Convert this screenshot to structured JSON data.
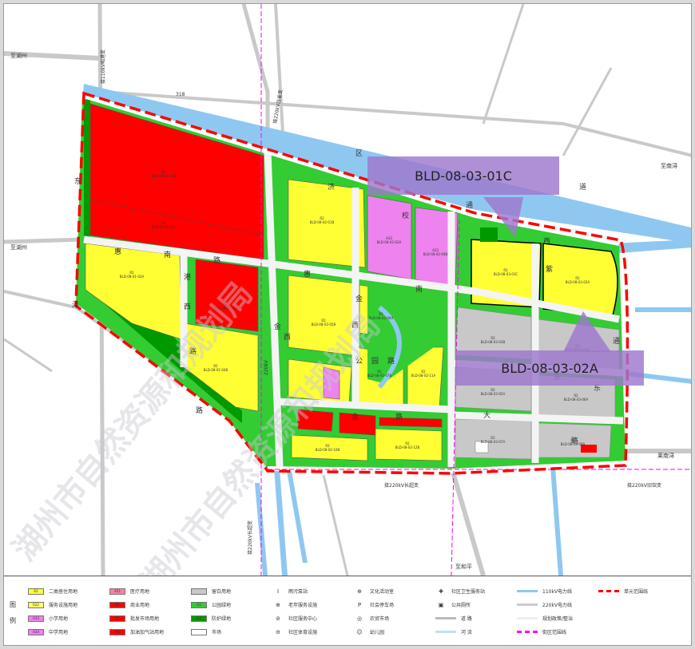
{
  "map": {
    "place_labels": {
      "to_huzhou_top": "至湖州",
      "to_huzhou_left": "至湖州",
      "to_nanxun": "至南浔",
      "to_lainan": "莱南浔",
      "to_heping": "至和平",
      "line_110kv": "接110kV昭港变",
      "line_220kv_left": "接220kV白雀变",
      "line_220kv_bottom": "接220kV长超变",
      "line_220kv_right": "接220kV旧馆变",
      "line_220kv_south": "接220kV长超变",
      "road_318": "318",
      "road_220kv_mid": "220kV"
    },
    "road_chars": {
      "hui": "惠",
      "nan": "南",
      "lu": "路",
      "jin": "金",
      "xi": "西",
      "dong": "东",
      "qu": "区",
      "tong": "通",
      "dao": "道",
      "ji": "济",
      "xiao": "校",
      "ze": "泽",
      "gong": "公",
      "yuan": "园",
      "gangxi": "港",
      "da": "大",
      "ziji": "紫",
      "shi": "示",
      "fan": "范",
      "zong": "综"
    },
    "parcel_codes": {
      "b_big": "B1\nBLD-08-01-01B",
      "b_big2": "B1\nBLD-08-01-01C",
      "r2_west": "R2\nBLD-08-01-02A",
      "b1_mid": "B1\nBLD-08-01-03A",
      "r2_w2": "R2\nBLD-08-01-04B",
      "r2_a": "R2\nBLD-08-02-01B",
      "a33_1": "A33\nBLD-08-02-03A",
      "a33_2": "A33\nBLD-08-02-04B",
      "r2_b": "R2\nBLD-08-02-05B",
      "r2_c": "R2\nBLD-08-02-06A",
      "r2_d": "R2\nBLD-08-02-07B",
      "r2_e": "R2\nBLD-08-02-11A",
      "r2_f": "R2\nBLD-08-02-12B",
      "r2_g": "R2\nBLD-08-02-10B",
      "r2_h": "R2\nBLD-08-03-01C",
      "r2_i": "R2\nBLD-08-03-02A",
      "gray_1": "R2\nBLD-08-03-03B",
      "gray_2": "R2\nBLD-08-03-04B",
      "gray_3": "R2\nBLD-08-03-05A",
      "gray_4": "R2\nBLD-08-03-06A",
      "gray_5": "R2\nBLD-08-03-07A",
      "gray_6": "R2\nBLD-08-03-08B"
    },
    "callouts": {
      "top": "BLD-08-03-01C",
      "bottom": "BLD-08-03-02A"
    },
    "watermark": "湖州市自然资源和规划局"
  },
  "legend": {
    "title": "图例",
    "items": [
      {
        "code": "R2",
        "label": "二类居住用地",
        "color": "#ffff33"
      },
      {
        "code": "R22",
        "label": "服务设施用地",
        "color": "#ffff66"
      },
      {
        "code": "A33",
        "label": "小学用地",
        "color": "#ee82ee"
      },
      {
        "code": "A33",
        "label": "中学用地",
        "color": "#ee82ee"
      },
      {
        "code": "A51",
        "label": "医疗用地",
        "color": "#ff7f9f"
      },
      {
        "code": "B1",
        "label": "商业用地",
        "color": "#ff0000"
      },
      {
        "code": "B1",
        "label": "批发市场用地",
        "color": "#ff0000"
      },
      {
        "code": "B4",
        "label": "加油加气站用地",
        "color": "#ff0000"
      },
      {
        "code": "",
        "label": "留白用地",
        "color": "#c8c8c8"
      },
      {
        "code": "G1",
        "label": "公园绿地",
        "color": "#33cc33"
      },
      {
        "code": "G2",
        "label": "防护绿地",
        "color": "#009900"
      },
      {
        "code": "",
        "label": "市场",
        "color": "#ffffff"
      },
      {
        "icon": "I",
        "label": "雨污泵站"
      },
      {
        "icon": "⊕",
        "label": "老年服务设施"
      },
      {
        "icon": "⊘",
        "label": "社区服务中心"
      },
      {
        "icon": "⊖",
        "label": "社区体育设施"
      },
      {
        "icon": "⊕",
        "label": "文化活动室"
      },
      {
        "icon": "P",
        "label": "社会停车场"
      },
      {
        "icon": "◎",
        "label": "农贸市场"
      },
      {
        "icon": "☺",
        "label": "幼儿园"
      },
      {
        "icon": "✚",
        "label": "社区卫生服务站"
      },
      {
        "icon": "▣",
        "label": "公共厕所"
      },
      {
        "line": "#bbbbbb",
        "label": "道 路"
      },
      {
        "line": "#bfe0ff",
        "label": "河 流"
      },
      {
        "line": "#8ec8f0",
        "label": "110kV电力线"
      },
      {
        "line": "#cccccc",
        "label": "220kV电力线"
      },
      {
        "line": "#eeeeee",
        "label": "规划政策/整治"
      },
      {
        "line": "#ff00ff",
        "label": "街区范围线"
      },
      {
        "line": "#ff0000",
        "label": "单元范围线"
      }
    ]
  }
}
